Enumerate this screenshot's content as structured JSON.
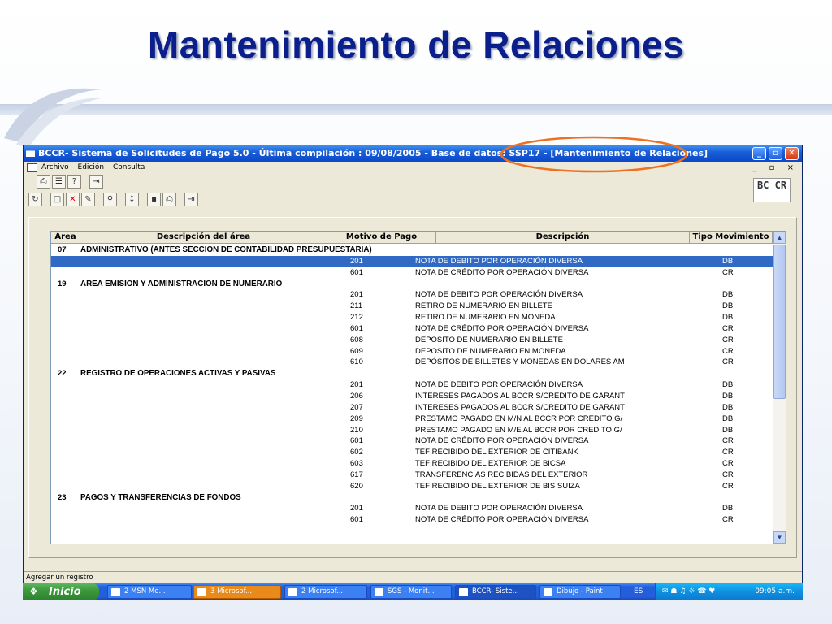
{
  "slide": {
    "title": "Mantenimiento de Relaciones"
  },
  "window": {
    "title": "BCCR- Sistema de Solicitudes de Pago 5.0 - Última compilación : 09/08/2005 - Base de datos: SSP17 - [Mantenimiento de Relaciones]",
    "menu": [
      "Archivo",
      "Edición",
      "Consulta"
    ],
    "logo_text": "BC CR",
    "status": "Agregar un registro"
  },
  "grid": {
    "headers": {
      "area": "Área",
      "area_desc": "Descripción del área",
      "motivo": "Motivo de Pago",
      "desc": "Descripción",
      "tipo": "Tipo Movimiento"
    },
    "rows": [
      {
        "group": true,
        "area": "07",
        "area_desc": "ADMINISTRATIVO (ANTES SECCION DE CONTABILIDAD PRESUPUESTARIA)"
      },
      {
        "motivo": "201",
        "desc": "NOTA DE DEBITO POR OPERACIÓN DIVERSA",
        "tipo": "DB",
        "selected": true
      },
      {
        "motivo": "601",
        "desc": "NOTA DE CRÉDITO POR OPERACIÓN DIVERSA",
        "tipo": "CR"
      },
      {
        "group": true,
        "area": "19",
        "area_desc": "AREA EMISION Y  ADMINISTRACION DE NUMERARIO"
      },
      {
        "motivo": "201",
        "desc": "NOTA DE DEBITO POR OPERACIÓN DIVERSA",
        "tipo": "DB"
      },
      {
        "motivo": "211",
        "desc": "RETIRO DE NUMERARIO EN BILLETE",
        "tipo": "DB"
      },
      {
        "motivo": "212",
        "desc": "RETIRO DE NUMERARIO EN MONEDA",
        "tipo": "DB"
      },
      {
        "motivo": "601",
        "desc": "NOTA DE CRÉDITO POR OPERACIÓN DIVERSA",
        "tipo": "CR"
      },
      {
        "motivo": "608",
        "desc": "DEPOSITO DE NUMERARIO EN BILLETE",
        "tipo": "CR"
      },
      {
        "motivo": "609",
        "desc": "DEPOSITO DE NUMERARIO EN MONEDA",
        "tipo": "CR"
      },
      {
        "motivo": "610",
        "desc": "DEPÓSITOS DE BILLETES Y MONEDAS EN DOLARES AM",
        "tipo": "CR"
      },
      {
        "group": true,
        "area": "22",
        "area_desc": "REGISTRO DE OPERACIONES ACTIVAS Y PASIVAS"
      },
      {
        "motivo": "201",
        "desc": "NOTA DE DEBITO POR OPERACIÓN DIVERSA",
        "tipo": "DB"
      },
      {
        "motivo": "206",
        "desc": "INTERESES PAGADOS AL BCCR S/CREDITO DE GARANT",
        "tipo": "DB"
      },
      {
        "motivo": "207",
        "desc": "INTERESES PAGADOS AL BCCR S/CREDITO DE GARANT",
        "tipo": "DB"
      },
      {
        "motivo": "209",
        "desc": "PRESTAMO PAGADO EN M/N AL BCCR POR CREDITO G/",
        "tipo": "DB"
      },
      {
        "motivo": "210",
        "desc": "PRESTAMO PAGADO EN M/E AL BCCR POR CREDITO G/",
        "tipo": "DB"
      },
      {
        "motivo": "601",
        "desc": "NOTA DE CRÉDITO POR OPERACIÓN DIVERSA",
        "tipo": "CR"
      },
      {
        "motivo": "602",
        "desc": "TEF RECIBIDO DEL EXTERIOR  DE CITIBANK",
        "tipo": "CR"
      },
      {
        "motivo": "603",
        "desc": "TEF  RECIBIDO DEL EXTERIOR DE BICSA",
        "tipo": "CR"
      },
      {
        "motivo": "617",
        "desc": "TRANSFERENCIAS RECIBIDAS DEL EXTERIOR",
        "tipo": "CR"
      },
      {
        "motivo": "620",
        "desc": "TEF RECIBIDO DEL EXTERIOR DE BIS SUIZA",
        "tipo": "CR"
      },
      {
        "group": true,
        "area": "23",
        "area_desc": "PAGOS Y TRANSFERENCIAS DE FONDOS"
      },
      {
        "motivo": "201",
        "desc": "NOTA DE DEBITO POR OPERACIÓN DIVERSA",
        "tipo": "DB"
      },
      {
        "motivo": "601",
        "desc": "NOTA DE CRÉDITO POR OPERACIÓN DIVERSA",
        "tipo": "CR"
      }
    ]
  },
  "taskbar": {
    "start": "Inicio",
    "buttons": [
      {
        "label": "2 MSN Me...",
        "icon": "msn-icon"
      },
      {
        "label": "3 Microsof...",
        "icon": "excel-icon",
        "active": true
      },
      {
        "label": "2 Microsof...",
        "icon": "powerpoint-icon"
      },
      {
        "label": "SGS - Monit...",
        "icon": "monitor-icon"
      },
      {
        "label": "BCCR- Siste...",
        "icon": "app-icon",
        "pressed": true
      },
      {
        "label": "Dibujo - Paint",
        "icon": "paint-icon"
      }
    ],
    "lang": "ES",
    "clock": "09:05 a.m."
  },
  "colors": {
    "title": "#0a1e8c",
    "selection": "#316ac5",
    "annotation_oval": "#f07020"
  }
}
